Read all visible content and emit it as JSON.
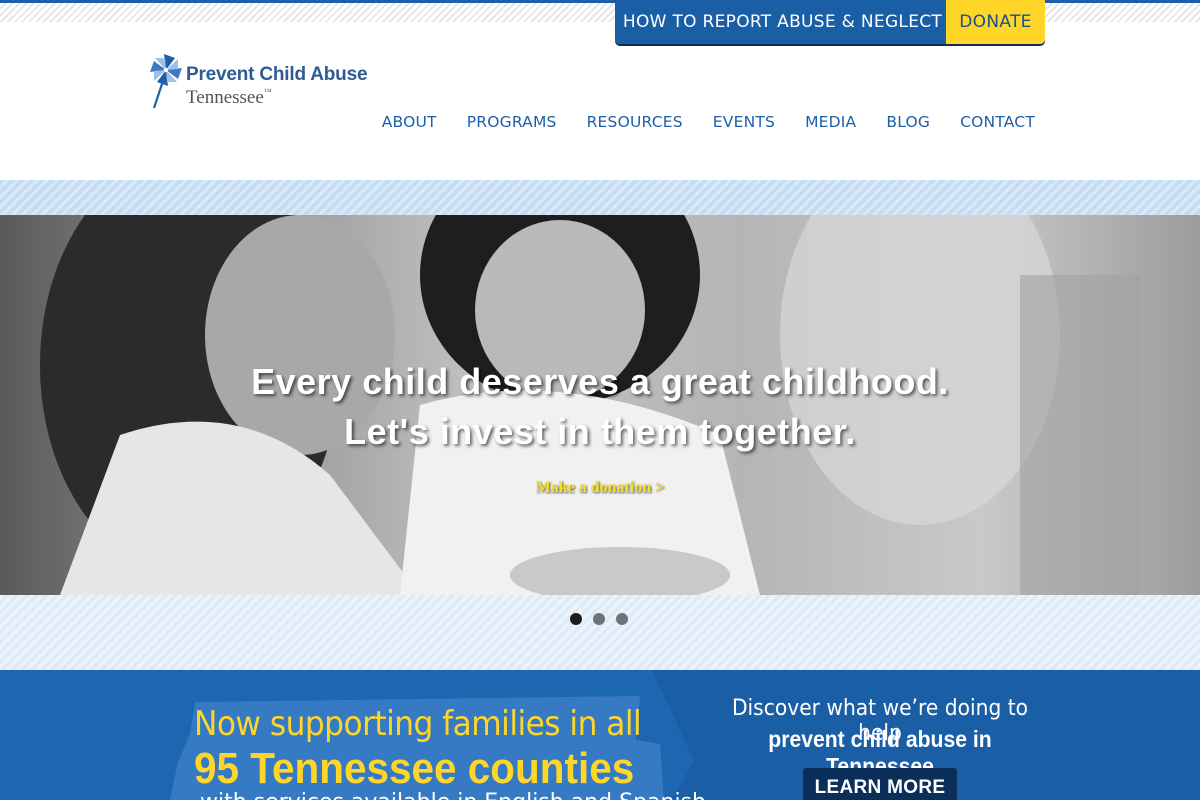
{
  "utility": {
    "report_label": "HOW TO REPORT ABUSE & NEGLECT",
    "donate_label": "DONATE"
  },
  "logo": {
    "line1": "Prevent Child Abuse",
    "line2": "Tennessee",
    "icon": "pinwheel-icon"
  },
  "nav": {
    "items": [
      {
        "label": "ABOUT"
      },
      {
        "label": "PROGRAMS"
      },
      {
        "label": "RESOURCES"
      },
      {
        "label": "EVENTS"
      },
      {
        "label": "MEDIA"
      },
      {
        "label": "BLOG"
      },
      {
        "label": "CONTACT"
      }
    ]
  },
  "hero": {
    "headline_line1": "Every child deserves a great childhood.",
    "headline_line2": "Let's invest in them together.",
    "cta_label": "Make a donation >",
    "slide_count": 3,
    "active_slide": 1
  },
  "promo": {
    "left_line1": "Now supporting families in all",
    "left_line2": "95 Tennessee counties",
    "left_line3": "with services available in English and Spanish",
    "right_line1": "Discover what we’re doing to help",
    "right_line2": "prevent child abuse in Tennessee",
    "button_label": "LEARN MORE"
  },
  "colors": {
    "brand_blue": "#1a5fa6",
    "accent_yellow": "#ffd628",
    "dark_navy": "#0c2f5a"
  }
}
